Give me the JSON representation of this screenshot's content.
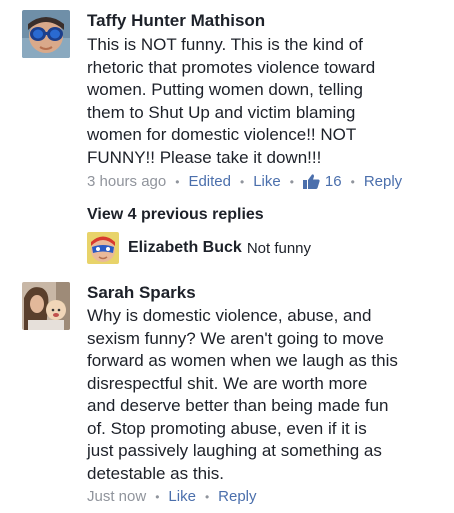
{
  "comments": [
    {
      "author": "Taffy Hunter Mathison",
      "avatar_icon": "avatar-goggles-photo",
      "text": "This is NOT funny. This is the kind of\nrhetoric that promotes violence toward\nwomen. Putting women down, telling\nthem to Shut Up and victim blaming\nwomen for domestic violence!! NOT\nFUNNY!! Please take it down!!!",
      "time": "3 hours ago",
      "edited": "Edited",
      "like_label": "Like",
      "like_count": "16",
      "reply_label": "Reply"
    },
    {
      "author": "Sarah Sparks",
      "avatar_icon": "avatar-mother-child-photo",
      "text": "Why is domestic violence, abuse, and\nsexism funny?  We aren't going to move\nforward as women when we laugh as this\ndisrespectful shit. We are worth more\nand deserve better than being made fun\nof. Stop promoting abuse, even if it is\njust passively laughing at something as\ndetestable as this.",
      "time": "Just now",
      "like_label": "Like",
      "reply_label": "Reply"
    }
  ],
  "replies": {
    "view_previous": "View 4 previous replies",
    "preview_author": "Elizabeth Buck",
    "preview_text": "Not funny",
    "preview_avatar_icon": "avatar-superhero-mask-photo"
  },
  "colors": {
    "link": "#4b6fac",
    "meta": "#90949c",
    "text": "#1d2129"
  }
}
